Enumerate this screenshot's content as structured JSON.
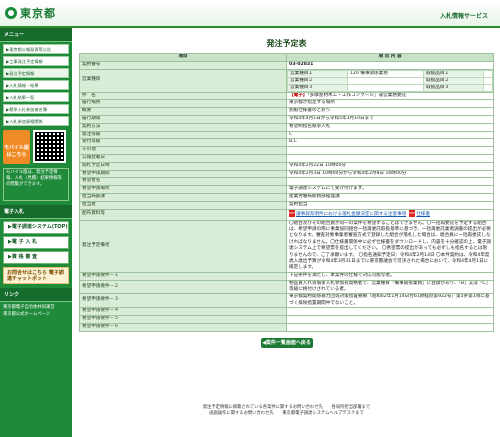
{
  "header": {
    "logo_text": "東京都",
    "service": "入札情報サービス"
  },
  "side": {
    "menu_title": "メニュー",
    "links": [
      "▶東京都公報発表等公告",
      "▶工事発注予定情報",
      "▶発注予定情報",
      "▶入札情報・結果",
      "▶入札結果一覧",
      "▶競争入札参加者名簿",
      "▶入札参加資格関係"
    ],
    "mobile_label": "モバイル版はこちら",
    "note": "モバイル版は、発注予定情報、入札（見積）結果情報等の閲覧ができます。",
    "sub_title": "電子入札",
    "buttons": [
      "▶電子調達システム(TOP)",
      "▶電 子 入 札",
      "▶資 格 審 査"
    ],
    "badge": "お問合せはこちら 電子調達チャットボット",
    "footer_title": "リンク",
    "footer_links": [
      "東京都電子自治体共同運営",
      "東京都公式ホームページ"
    ]
  },
  "main": {
    "title": "発注予定表",
    "head": [
      "項目",
      "項 目 内 容"
    ],
    "contract_no_label": "契約番号",
    "contract_no": "03-02831",
    "business_label": "営業種目",
    "business_rows": [
      [
        "営業種目１",
        "120 備事関係業務",
        "取扱品目１",
        ""
      ],
      [
        "営業種目２",
        "",
        "取扱品目２",
        ""
      ],
      [
        "営業種目３",
        "",
        "取扱品目３",
        ""
      ]
    ],
    "subject_label": "件　名",
    "subject_tag": "【電子】",
    "subject": "「多摩産材木工・工作コンクール」運営業務委託",
    "rows": [
      [
        "履行場所",
        "東京都が指定する場所"
      ],
      [
        "概要",
        "別紙仕様書のとおり"
      ],
      [
        "履行期間",
        "令和4年4月1日から令和5年3月10日まで"
      ],
      [
        "契約方法",
        "希望制指名競争入札"
      ],
      [
        "発注等級",
        "C"
      ],
      [
        "受付等級",
        "B,C"
      ],
      [
        "その他",
        ""
      ],
      [
        "公報登載日",
        ""
      ],
      [
        "閲札予定日時",
        "令和4年2月22日 10時00分"
      ],
      [
        "希望申請期間",
        "令和4年2月3日 10時00分から令和4年2月8日 16時00分"
      ],
      [
        "希望者名",
        ""
      ],
      [
        "希望申請場所",
        "電子調達システムにて受け付けます。"
      ],
      [
        "担当局部課",
        "産業労働局総務部経理課"
      ],
      [
        "担当者",
        "契約担当"
      ]
    ],
    "docs_label": "配布資料等",
    "docs": [
      "議事録及明件における落札金額決定に関する注意事項",
      "仕様書"
    ],
    "remarks_label": "発注予定備考",
    "remarks": "〇組合及びその組合員が同一の案件を希望することはできません。〇一括再委託を予定する組合は、希望申請の際に事業協同組合一括再委託取扱基準に基づき、一括再委託業者調書の提出が必要となります。審査対象事業者審査方式で登録した組合が落札した場合は、組合員に一括再委託しなければなりません。〇仕様書関係中に必ず仕様書をダウンロードし、内容を十分確認の上、電子調達システム上で希望票を提出してください。 〇希望票の提出があっても必ずしも指名するとは限りませんので、ご了承願います。 〇指名通知予定日：令和4年2月14日 〇本件契約は、令和4年度歳入歳出予算が令和4年3月31日までに東京都議会で可決された場合において、令和4年4月1日に確定します。",
    "conditions": [
      [
        "希望申請要件－１",
        "下記条件を満たし、本案件の仕様で対応可能な者。"
      ],
      [
        "希望申請要件－２",
        "物品買入れ等競争入札参加有資格者で、営業種目「備事関係業務」に登録があり、「B」又は「C」等級に格付けされている者。"
      ],
      [
        "希望申請要件－３",
        "東京都契約関係暴力団等対策措置要綱（昭和62年1月14日付61財経庶第922号）第5条第1項に基づく排除措置期間中でないこと。"
      ],
      [
        "希望申請要件－４",
        ""
      ],
      [
        "希望申請要件－５",
        ""
      ],
      [
        "希望申請要件－６",
        ""
      ]
    ],
    "return_button": "◀案件一覧画面へ戻る"
  },
  "footer": {
    "line1": "発注予定情報に掲載されている各案件に関するお問い合わせ先　　各局所担当部署まで",
    "line2": "画面操作に関するお問い合わせ先　　東京都電子調達システムヘルプデスクまで"
  }
}
